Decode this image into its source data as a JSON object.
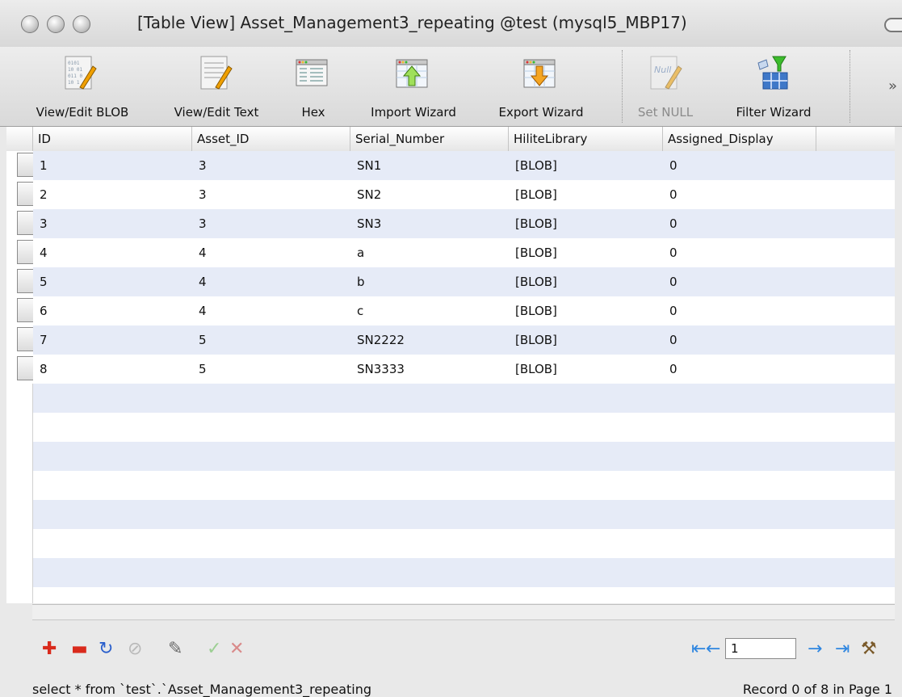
{
  "window": {
    "title": "[Table View] Asset_Management3_repeating @test (mysql5_MBP17)"
  },
  "toolbar": {
    "items": [
      {
        "label": "View/Edit BLOB",
        "icon": "blob-edit-icon",
        "enabled": true
      },
      {
        "label": "View/Edit Text",
        "icon": "text-edit-icon",
        "enabled": true
      },
      {
        "label": "Hex",
        "icon": "hex-icon",
        "enabled": true
      },
      {
        "label": "Import Wizard",
        "icon": "import-icon",
        "enabled": true
      },
      {
        "label": "Export Wizard",
        "icon": "export-icon",
        "enabled": true
      },
      {
        "label": "Set NULL",
        "icon": "null-icon",
        "enabled": false
      },
      {
        "label": "Filter Wizard",
        "icon": "filter-icon",
        "enabled": true
      }
    ],
    "null_icon_text": "Null",
    "more": "»"
  },
  "table": {
    "columns": [
      "ID",
      "Asset_ID",
      "Serial_Number",
      "HiliteLibrary",
      "Assigned_Display"
    ],
    "rows": [
      [
        "1",
        "3",
        "SN1",
        "[BLOB]",
        "0"
      ],
      [
        "2",
        "3",
        "SN2",
        "[BLOB]",
        "0"
      ],
      [
        "3",
        "3",
        "SN3",
        "[BLOB]",
        "0"
      ],
      [
        "4",
        "4",
        "a",
        "[BLOB]",
        "0"
      ],
      [
        "5",
        "4",
        "b",
        "[BLOB]",
        "0"
      ],
      [
        "6",
        "4",
        "c",
        "[BLOB]",
        "0"
      ],
      [
        "7",
        "5",
        "SN2222",
        "[BLOB]",
        "0"
      ],
      [
        "8",
        "5",
        "SN3333",
        "[BLOB]",
        "0"
      ]
    ]
  },
  "bottom": {
    "record_buttons": [
      {
        "name": "add-record-icon",
        "glyph": "✚",
        "color": "#d92a1c"
      },
      {
        "name": "delete-record-icon",
        "glyph": "▬",
        "color": "#d92a1c"
      },
      {
        "name": "refresh-icon",
        "glyph": "↻",
        "color": "#2a5fcc"
      },
      {
        "name": "stop-icon",
        "glyph": "⊘",
        "color": "#b8b8b8"
      },
      {
        "name": "edit-record-icon",
        "glyph": "✎",
        "color": "#6a6a6a"
      },
      {
        "name": "apply-icon",
        "glyph": "✓",
        "color": "#9ccf93"
      },
      {
        "name": "discard-icon",
        "glyph": "✕",
        "color": "#d98a8a"
      }
    ],
    "page_value": "1",
    "nav_buttons": [
      {
        "name": "first-page-icon",
        "glyph": "⇤",
        "color": "#2f86e0"
      },
      {
        "name": "prev-page-icon",
        "glyph": "←",
        "color": "#2f86e0"
      },
      {
        "name": "next-page-icon",
        "glyph": "→",
        "color": "#2f86e0"
      },
      {
        "name": "last-page-icon",
        "glyph": "⇥",
        "color": "#2f86e0"
      },
      {
        "name": "page-settings-icon",
        "glyph": "⚒",
        "color": "#7a5a2a"
      }
    ],
    "query": "select * from `test`.`Asset_Management3_repeating",
    "record_status": "Record 0 of 8 in Page 1"
  }
}
